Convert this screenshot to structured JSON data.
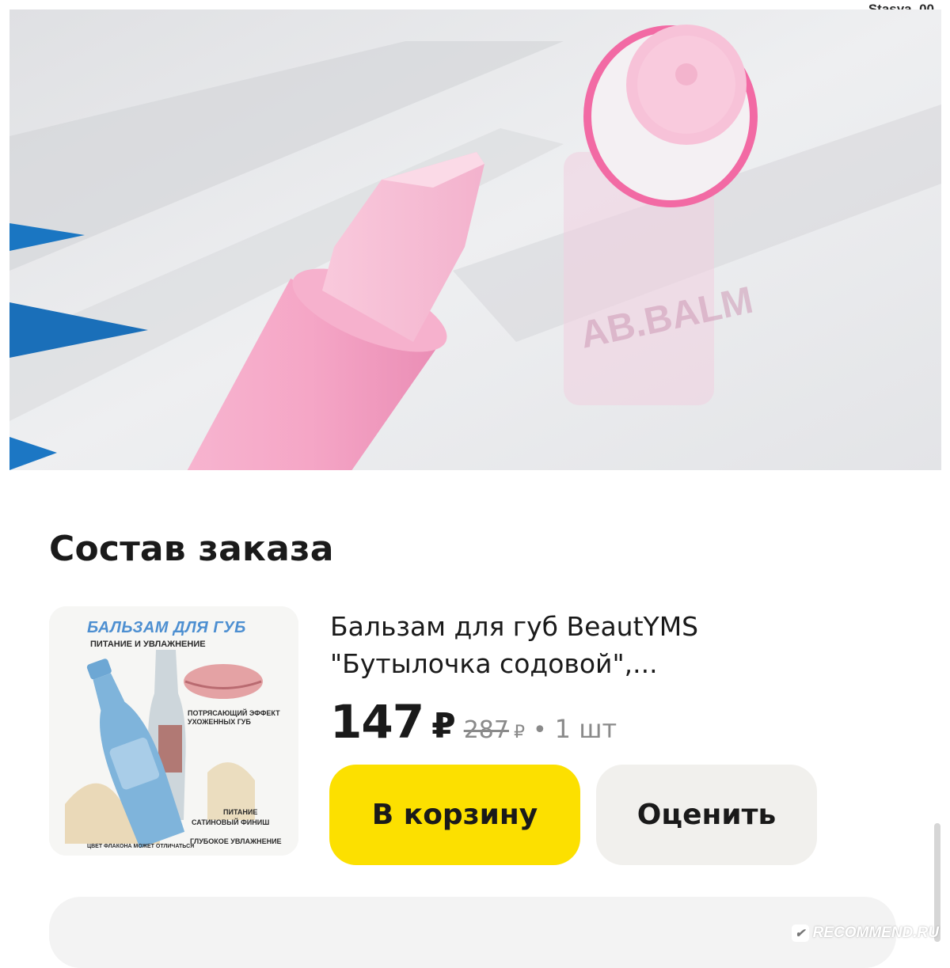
{
  "watermark_top": "Stasya_00",
  "photo_alt": "lip-balm-photo",
  "section": {
    "title": "Состав заказа"
  },
  "thumbnail": {
    "heading": "БАЛЬЗАМ ДЛЯ ГУБ",
    "subheading": "ПИТАНИЕ И УВЛАЖНЕНИЕ",
    "effect_text": "ПОТРЯСАЮЩИЙ ЭФФЕКТ УХОЖЕННЫХ ГУБ",
    "feature_1": "ПИТАНИЕ",
    "feature_2": "САТИНОВЫЙ ФИНИШ",
    "feature_3": "ГЛУБОКОЕ УВЛАЖНЕНИЕ",
    "footnote": "ЦВЕТ ФЛАКОНА МОЖЕТ ОТЛИЧАТЬСЯ"
  },
  "product": {
    "name": "Бальзам для губ BeautYMS \"Бутылочка содовой\",...",
    "price": "147",
    "currency": "₽",
    "old_price": "287",
    "old_currency": "₽",
    "separator": "•",
    "quantity": "1 шт"
  },
  "buttons": {
    "cart_label": "В корзину",
    "rate_label": "Оценить"
  },
  "colors": {
    "cart_button": "#fce000",
    "rate_button": "#f1f0ed",
    "accent_pink": "#f48db8"
  },
  "watermark_bottom": "RECOMMEND.RU"
}
